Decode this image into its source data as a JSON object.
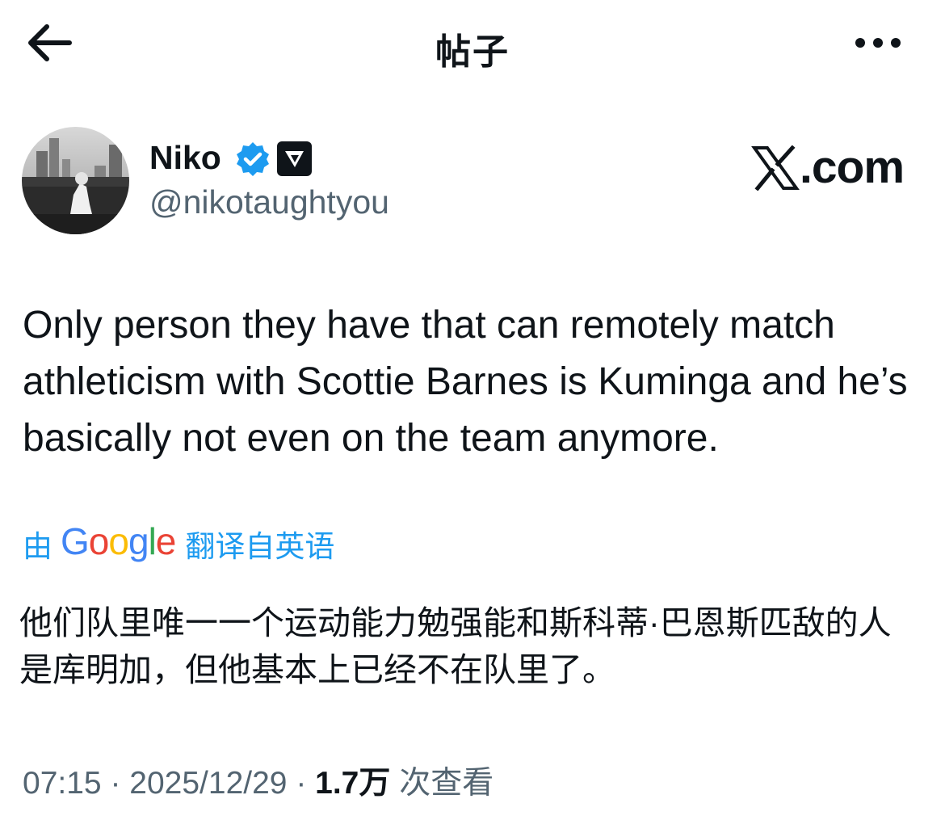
{
  "header": {
    "title": "帖子",
    "back_icon": "arrow-left-icon",
    "more_icon": "more-horizontal-icon"
  },
  "author": {
    "name": "Niko",
    "handle": "@nikotaughtyou",
    "verified_icon": "verified-badge-icon",
    "affiliation_icon": "affiliate-badge-icon",
    "avatar": "avatar"
  },
  "watermark": {
    "text": ".com",
    "x_logo": "x-logo-icon"
  },
  "tweet": {
    "text": "Only person they have that can remotely match athleticism with Scottie Barnes is Kuminga and he’s basically not even on the team anymore."
  },
  "translation": {
    "by_label": "由",
    "provider": "Google",
    "from_label": "翻译自英语",
    "text": "他们队里唯一一个运动能力勉强能和斯科蒂·巴恩斯匹敌的人是库明加，但他基本上已经不在队里了。"
  },
  "meta": {
    "time": "07:15",
    "separator": " · ",
    "date": "2025/12/29",
    "views_count": "1.7万",
    "views_label": " 次查看"
  },
  "colors": {
    "text": "#0f1419",
    "secondary": "#536471",
    "link": "#1d9bf0",
    "verified": "#1d9bf0"
  }
}
